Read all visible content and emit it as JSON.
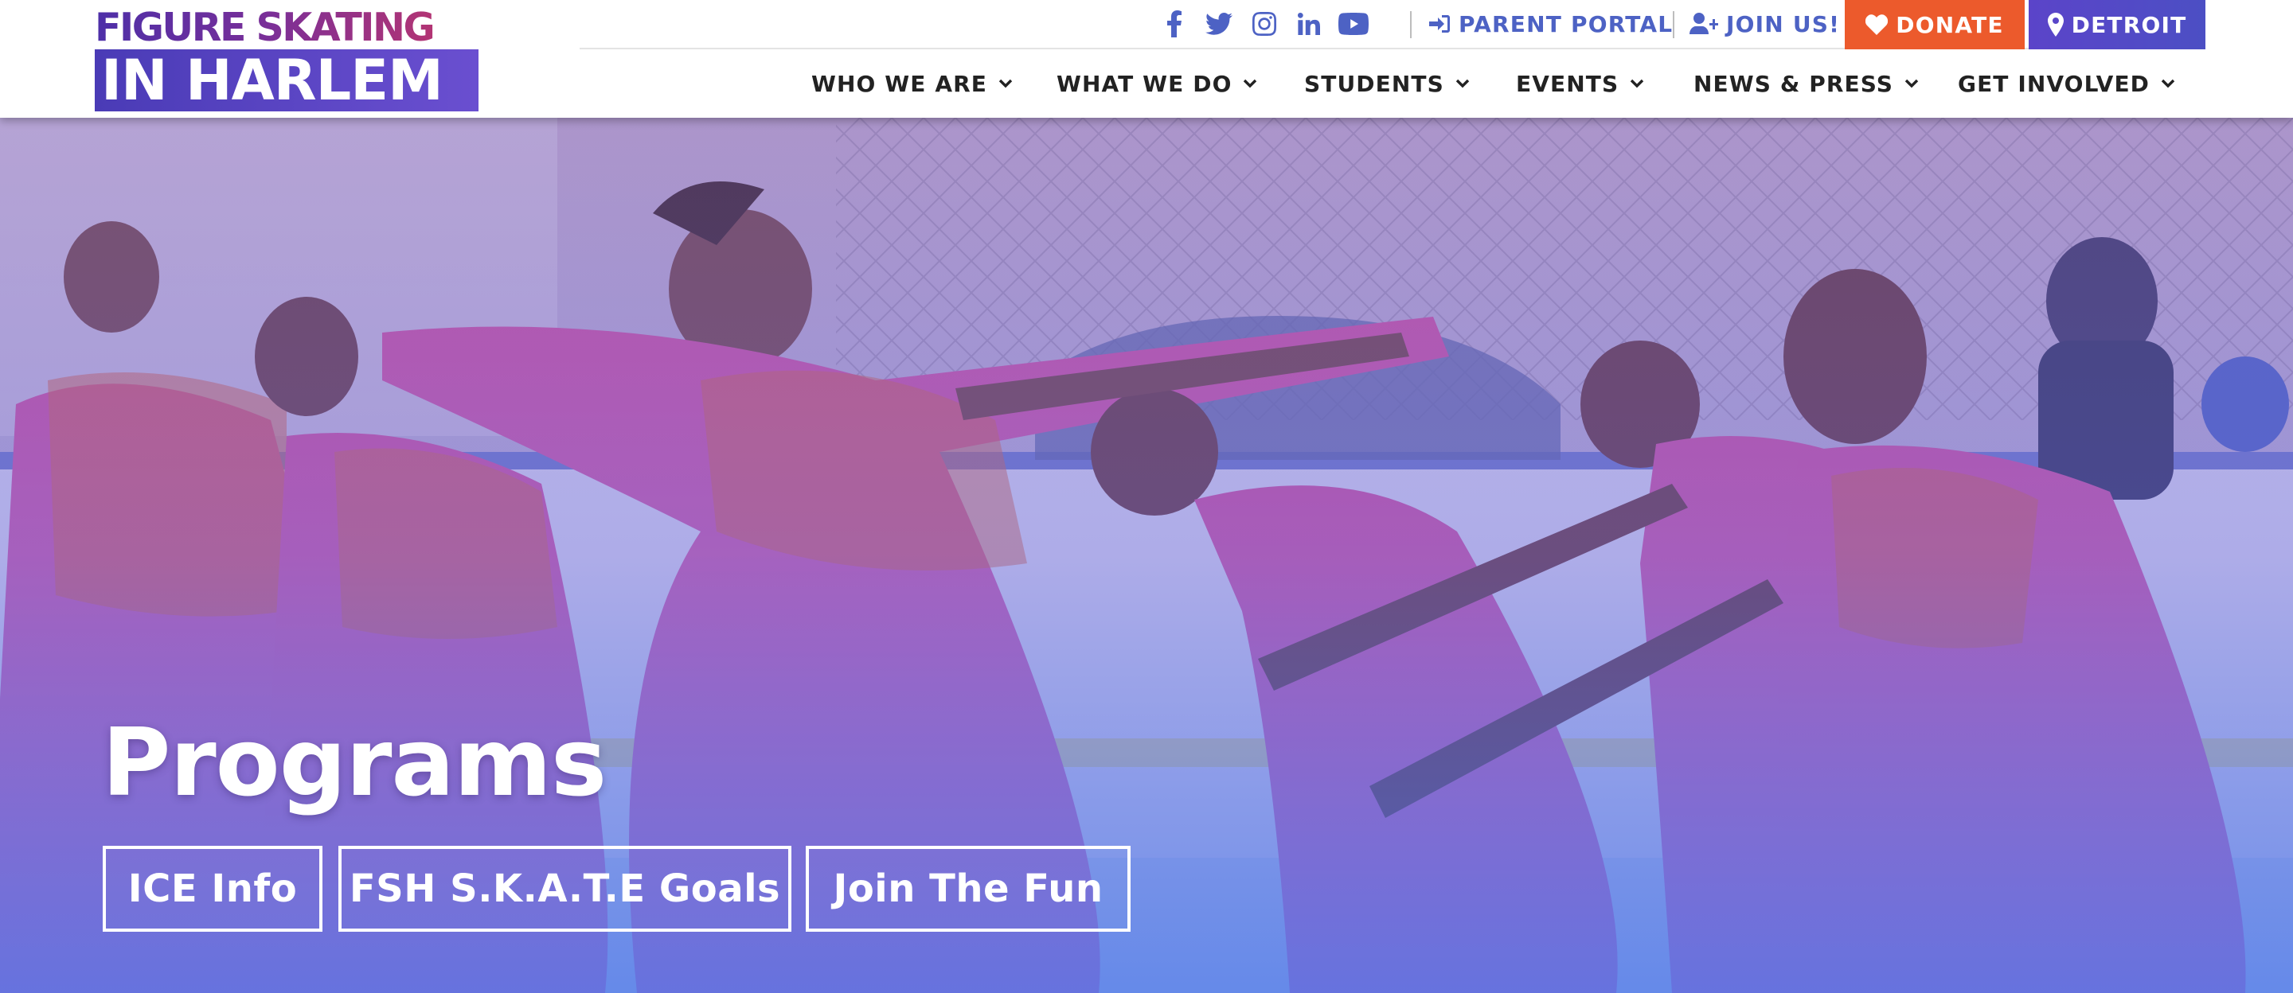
{
  "logo": {
    "line1": "FIGURE SKATING",
    "line2": "IN HARLEM"
  },
  "utility": {
    "social_icons": [
      "facebook-icon",
      "twitter-icon",
      "instagram-icon",
      "linkedin-icon",
      "youtube-icon"
    ],
    "parent_portal": "PARENT PORTAL",
    "join_us": "JOIN US!",
    "donate": "DONATE",
    "detroit": "DETROIT"
  },
  "nav": {
    "items": [
      {
        "label": "WHO WE ARE"
      },
      {
        "label": "WHAT WE DO"
      },
      {
        "label": "STUDENTS"
      },
      {
        "label": "EVENTS"
      },
      {
        "label": "NEWS & PRESS"
      },
      {
        "label": "GET INVOLVED"
      }
    ]
  },
  "hero": {
    "title": "Programs",
    "buttons": [
      {
        "label": "ICE Info"
      },
      {
        "label": "FSH S.K.A.T.E Goals"
      },
      {
        "label": "Join The Fun"
      }
    ]
  },
  "colors": {
    "accent_blue": "#4d62c4",
    "donate_orange": "#ec5a2c",
    "detroit_purple": "#5b44c9",
    "logo_purple": "#8a2d8e",
    "nav_text": "#222222",
    "hero_overlay": "#6a5fd0"
  }
}
